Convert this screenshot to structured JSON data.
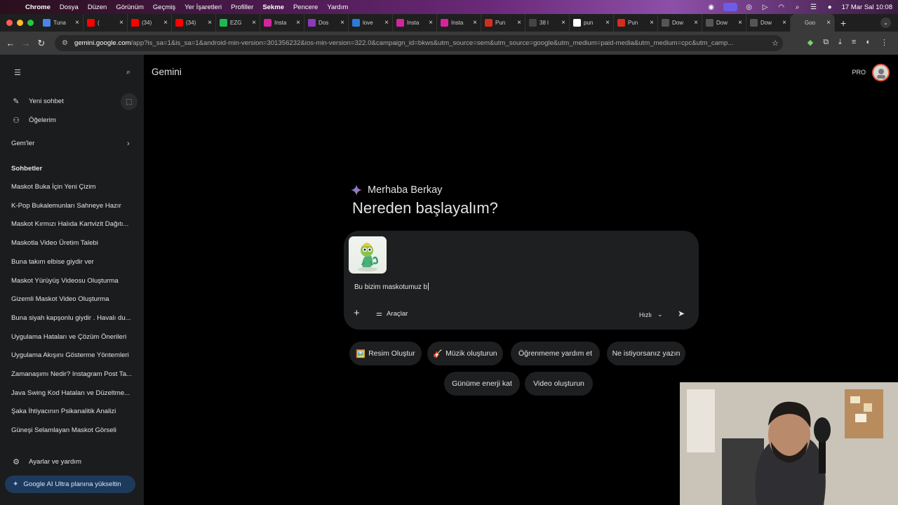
{
  "menubar": {
    "items": [
      "Chrome",
      "Dosya",
      "Düzen",
      "Görünüm",
      "Geçmiş",
      "Yer İşaretleri",
      "Profiller",
      "Sekme",
      "Pencere",
      "Yardım"
    ],
    "clock": "17 Mar Sal  10:08"
  },
  "tabs": [
    {
      "title": "Tuna",
      "fav": "doc",
      "color": "#4a86e8"
    },
    {
      "title": "(",
      "fav": "yt",
      "color": "#ff0000"
    },
    {
      "title": "(34)",
      "fav": "yt",
      "color": "#ff0000"
    },
    {
      "title": "(34)",
      "fav": "yt",
      "color": "#ff0000"
    },
    {
      "title": "EZG",
      "fav": "spotify",
      "color": "#1db954"
    },
    {
      "title": "Insta",
      "fav": "ig",
      "color": "#d6249f"
    },
    {
      "title": "Dos",
      "fav": "dos",
      "color": "#8a3ab9"
    },
    {
      "title": "love",
      "fav": "edge",
      "color": "#2b7bd9"
    },
    {
      "title": "Insta",
      "fav": "ig",
      "color": "#d6249f"
    },
    {
      "title": "Insta",
      "fav": "ig",
      "color": "#d6249f"
    },
    {
      "title": "Pun",
      "fav": "on",
      "color": "#d62d20"
    },
    {
      "title": "38 l",
      "fav": "E",
      "color": "#444444"
    },
    {
      "title": "pun",
      "fav": "g",
      "color": "#ffffff"
    },
    {
      "title": "Pun",
      "fav": "on",
      "color": "#d62d20"
    },
    {
      "title": "Dow",
      "fav": "W",
      "color": "#555555"
    },
    {
      "title": "Dow",
      "fav": "W",
      "color": "#555555"
    },
    {
      "title": "Dow",
      "fav": "W",
      "color": "#555555"
    },
    {
      "title": "Goo",
      "fav": "gem",
      "color": "#3a3a3a",
      "active": true
    }
  ],
  "address": {
    "host": "gemini.google.com",
    "path": "/app?is_sa=1&is_sa=1&android-min-version=301356232&ios-min-version=322.0&campaign_id=bkws&utm_source=sem&utm_source=google&utm_medium=paid-media&utm_medium=cpc&utm_camp..."
  },
  "sidebar": {
    "new_chat": "Yeni sohbet",
    "my_items": "Öğelerim",
    "gems": "Gem'ler",
    "chats_title": "Sohbetler",
    "chats": [
      "Maskot Buka İçin Yeni Çizim",
      "K-Pop Bukalemunları Sahneye Hazır",
      "Maskot Kırmızı Halıda Kartvizit Dağıtı...",
      "Maskotla Video Üretim Talebi",
      "Buna takım elbise giydir ver",
      "Maskot Yürüyüş Videosu Oluşturma",
      "Gizemli Maskot Video Oluşturma",
      "Buna siyah kapşonlu giydir . Havalı du...",
      "Uygulama Hataları ve Çözüm Önerileri",
      "Uygulama Akışını Gösterme Yöntemleri",
      "Zamanaşımı Nedir? Instagram Post Ta...",
      "Java Swing Kod Hataları ve Düzeltme...",
      "Şaka İhtiyacının Psikanalitik Analizi",
      "Güneşi Selamlayan Maskot Görseli"
    ],
    "settings": "Ayarlar ve yardım",
    "upgrade": "Google AI Ultra planına yükseltin"
  },
  "main": {
    "brand": "Gemini",
    "pro_badge": "PRO",
    "greeting": "Merhaba Berkay",
    "heading": "Nereden başlayalım?",
    "prompt_text": "Bu bizim maskotumuz b",
    "tools_label": "Araçlar",
    "speed_label": "Hızlı",
    "chips_row1": [
      {
        "emoji": "🖼️",
        "label": "Resim Oluştur"
      },
      {
        "emoji": "🎸",
        "label": "Müzik oluşturun"
      },
      {
        "emoji": "",
        "label": "Öğrenmeme yardım et"
      },
      {
        "emoji": "",
        "label": "Ne istiyorsanız yazın"
      }
    ],
    "chips_row2": [
      {
        "emoji": "",
        "label": "Günüme enerji kat"
      },
      {
        "emoji": "",
        "label": "Video oluşturun"
      }
    ]
  }
}
